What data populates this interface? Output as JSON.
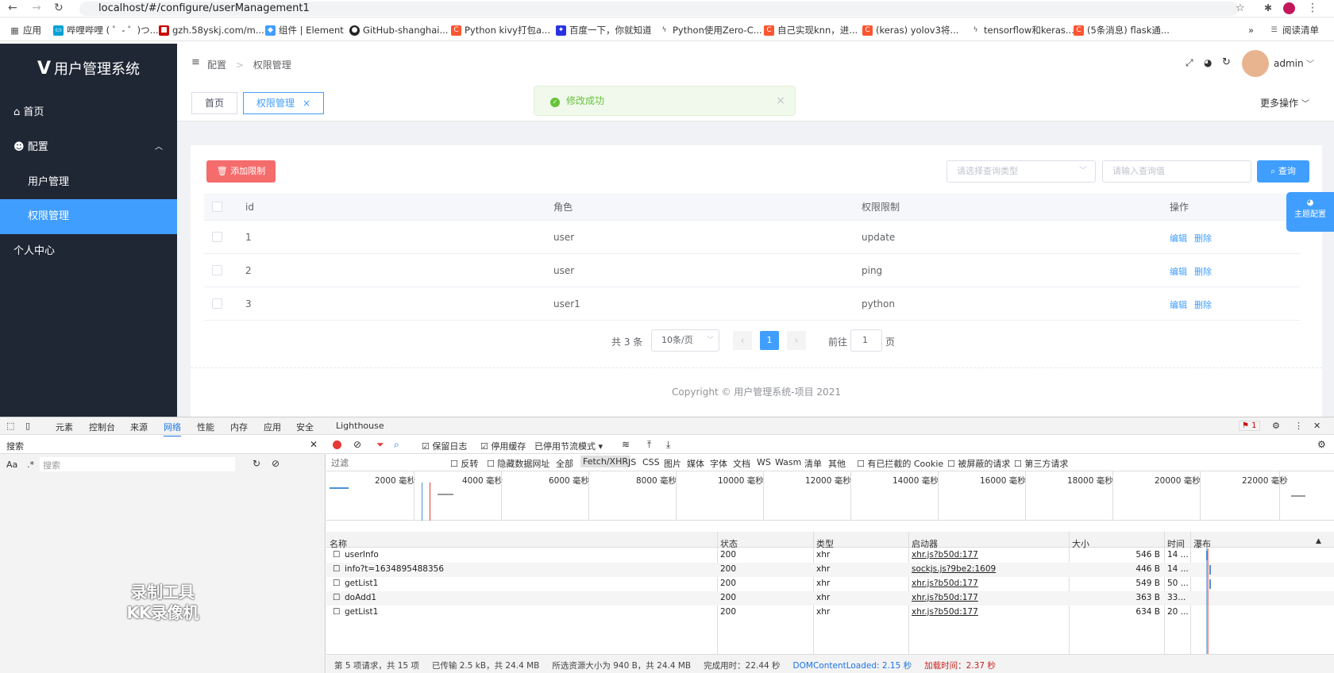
{
  "browser": {
    "url": "localhost/#/configure/userManagement1",
    "bookmarks": [
      "应用",
      "哔哩哔哩 ( ゜- ゜)つ...",
      "gzh.58yskj.com/m...",
      "组件 | Element",
      "GitHub-shanghai...",
      "Python kivy打包a...",
      "百度一下，你就知道",
      "Python使用Zero-C...",
      "自己实现knn，进...",
      "(keras) yolov3将...",
      "tensorflow和keras...",
      "(5条消息) flask通..."
    ],
    "reading_list": "阅读清单"
  },
  "sidebar": {
    "title": "用户管理系统",
    "items": [
      {
        "label": "首页"
      },
      {
        "label": "配置"
      },
      {
        "label": "用户管理"
      },
      {
        "label": "权限管理"
      },
      {
        "label": "个人中心"
      }
    ]
  },
  "header": {
    "breadcrumb": [
      "配置",
      "权限管理"
    ],
    "user": "admin"
  },
  "tags": {
    "home": "首页",
    "current": "权限管理"
  },
  "more_ops": "更多操作",
  "toast": "修改成功",
  "toolbar": {
    "add": "添加限制",
    "select_placeholder": "请选择查询类型",
    "input_placeholder": "请输入查询值",
    "query": "查询"
  },
  "table": {
    "headers": [
      "id",
      "角色",
      "权限限制",
      "操作"
    ],
    "rows": [
      {
        "id": "1",
        "role": "user",
        "perm": "update"
      },
      {
        "id": "2",
        "role": "user",
        "perm": "ping"
      },
      {
        "id": "3",
        "role": "user1",
        "perm": "python"
      }
    ],
    "edit": "编辑",
    "delete": "删除"
  },
  "pager": {
    "total": "共 3 条",
    "size": "10条/页",
    "page": "1",
    "goto": "前往",
    "goto_value": "1",
    "unit": "页"
  },
  "copyright": "Copyright © 用户管理系统-项目 2021",
  "theme_btn": "主题配置",
  "watermark": [
    "录制工具",
    "KK录像机"
  ],
  "devtools": {
    "tabs": [
      "元素",
      "控制台",
      "来源",
      "网络",
      "性能",
      "内存",
      "应用",
      "安全",
      "Lighthouse"
    ],
    "badge": "1",
    "search_title": "搜索",
    "search_placeholder": "搜索",
    "toolbar": {
      "preserve": "保留日志",
      "disable_cache": "停用缓存",
      "throttle": "已停用节流模式"
    },
    "filter": {
      "placeholder": "过滤",
      "invert": "反转",
      "hide_data": "隐藏数据网址",
      "types": [
        "全部",
        "Fetch/XHR",
        "JS",
        "CSS",
        "图片",
        "媒体",
        "字体",
        "文档",
        "WS",
        "Wasm",
        "清单",
        "其他"
      ],
      "blocked_cookies": "有已拦截的 Cookie",
      "blocked_requests": "被屏蔽的请求",
      "third_party": "第三方请求"
    },
    "timeline": [
      "2000 毫秒",
      "4000 毫秒",
      "6000 毫秒",
      "8000 毫秒",
      "10000 毫秒",
      "12000 毫秒",
      "14000 毫秒",
      "16000 毫秒",
      "18000 毫秒",
      "20000 毫秒",
      "22000 毫秒"
    ],
    "columns": [
      "名称",
      "状态",
      "类型",
      "启动器",
      "大小",
      "时间",
      "瀑布"
    ],
    "requests": [
      {
        "name": "userInfo",
        "status": "200",
        "type": "xhr",
        "initiator": "xhr.js?b50d:177",
        "size": "546 B",
        "time": "14 ..."
      },
      {
        "name": "info?t=1634895488356",
        "status": "200",
        "type": "xhr",
        "initiator": "sockjs.js?9be2:1609",
        "size": "446 B",
        "time": "14 ..."
      },
      {
        "name": "getList1",
        "status": "200",
        "type": "xhr",
        "initiator": "xhr.js?b50d:177",
        "size": "549 B",
        "time": "50 ..."
      },
      {
        "name": "doAdd1",
        "status": "200",
        "type": "xhr",
        "initiator": "xhr.js?b50d:177",
        "size": "363 B",
        "time": "33..."
      },
      {
        "name": "getList1",
        "status": "200",
        "type": "xhr",
        "initiator": "xhr.js?b50d:177",
        "size": "634 B",
        "time": "20 ..."
      }
    ],
    "status": {
      "count": "第 5 项请求，共 15 项",
      "transferred": "已传输 2.5 kB，共 24.4 MB",
      "resources": "所选资源大小为 940 B，共 24.4 MB",
      "finish": "完成用时：22.44 秒",
      "dcl": "DOMContentLoaded: 2.15 秒",
      "load": "加载时间：2.37 秒"
    }
  }
}
